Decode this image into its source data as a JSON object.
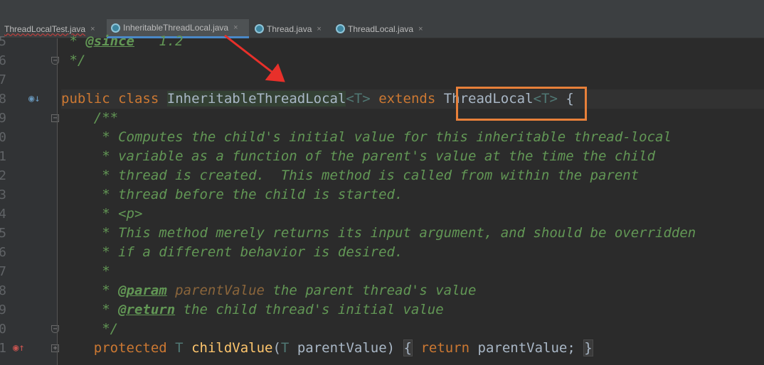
{
  "tabs": [
    {
      "label": "ThreadLocalTest.java",
      "active": false
    },
    {
      "label": "InheritableThreadLocal.java",
      "active": true
    },
    {
      "label": "Thread.java",
      "active": false
    },
    {
      "label": "ThreadLocal.java",
      "active": false
    }
  ],
  "close_glyph": "×",
  "gutter": {
    "line_numbers": [
      "5",
      "6",
      "7",
      "8",
      "9",
      "0",
      "1",
      "2",
      "3",
      "4",
      "5",
      "6",
      "7",
      "8",
      "9",
      "0",
      "1"
    ],
    "implemented_icon": "implemented-method-icon",
    "overrides_icon": "overrides-method-icon"
  },
  "code": {
    "l1": {
      "a": " * ",
      "tag": "@since",
      "b": "   1.2"
    },
    "l2": " */",
    "l4": {
      "kw1": "public",
      "kw2": "class",
      "name": "InheritableThreadLocal",
      "tparam": "<T>",
      "kw3": "extends",
      "super": "ThreadLocal",
      "super_tparam": "<T>",
      "brace": "{"
    },
    "l5": "    /**",
    "l6": "     * Computes the child's initial value for this inheritable thread-local",
    "l7": "     * variable as a function of the parent's value at the time the child",
    "l8": "     * thread is created.  This method is called from within the parent",
    "l9": "     * thread before the child is started.",
    "l10": {
      "a": "     * ",
      "html": "<p>"
    },
    "l11": "     * This method merely returns its input argument, and should be overridden",
    "l12": "     * if a different behavior is desired.",
    "l13": "     *",
    "l14": {
      "a": "     * ",
      "tag": "@param",
      "sp": " ",
      "param": "parentValue",
      "b": " the parent thread's value"
    },
    "l15": {
      "a": "     * ",
      "tag": "@return",
      "b": " the child thread's initial value"
    },
    "l16": "     */",
    "l17": {
      "indent": "    ",
      "kw": "protected",
      "type": "T",
      "fn": "childValue",
      "p1": "(",
      "ptype": "T",
      "pname": " parentValue)",
      "ob": "{",
      "ret": "return",
      "body": " parentValue;",
      "cb": "}"
    }
  },
  "colors": {
    "accent_tab_underline": "#4A88C7",
    "highlight_box": "#E8803A",
    "arrow": "#E8302A"
  }
}
